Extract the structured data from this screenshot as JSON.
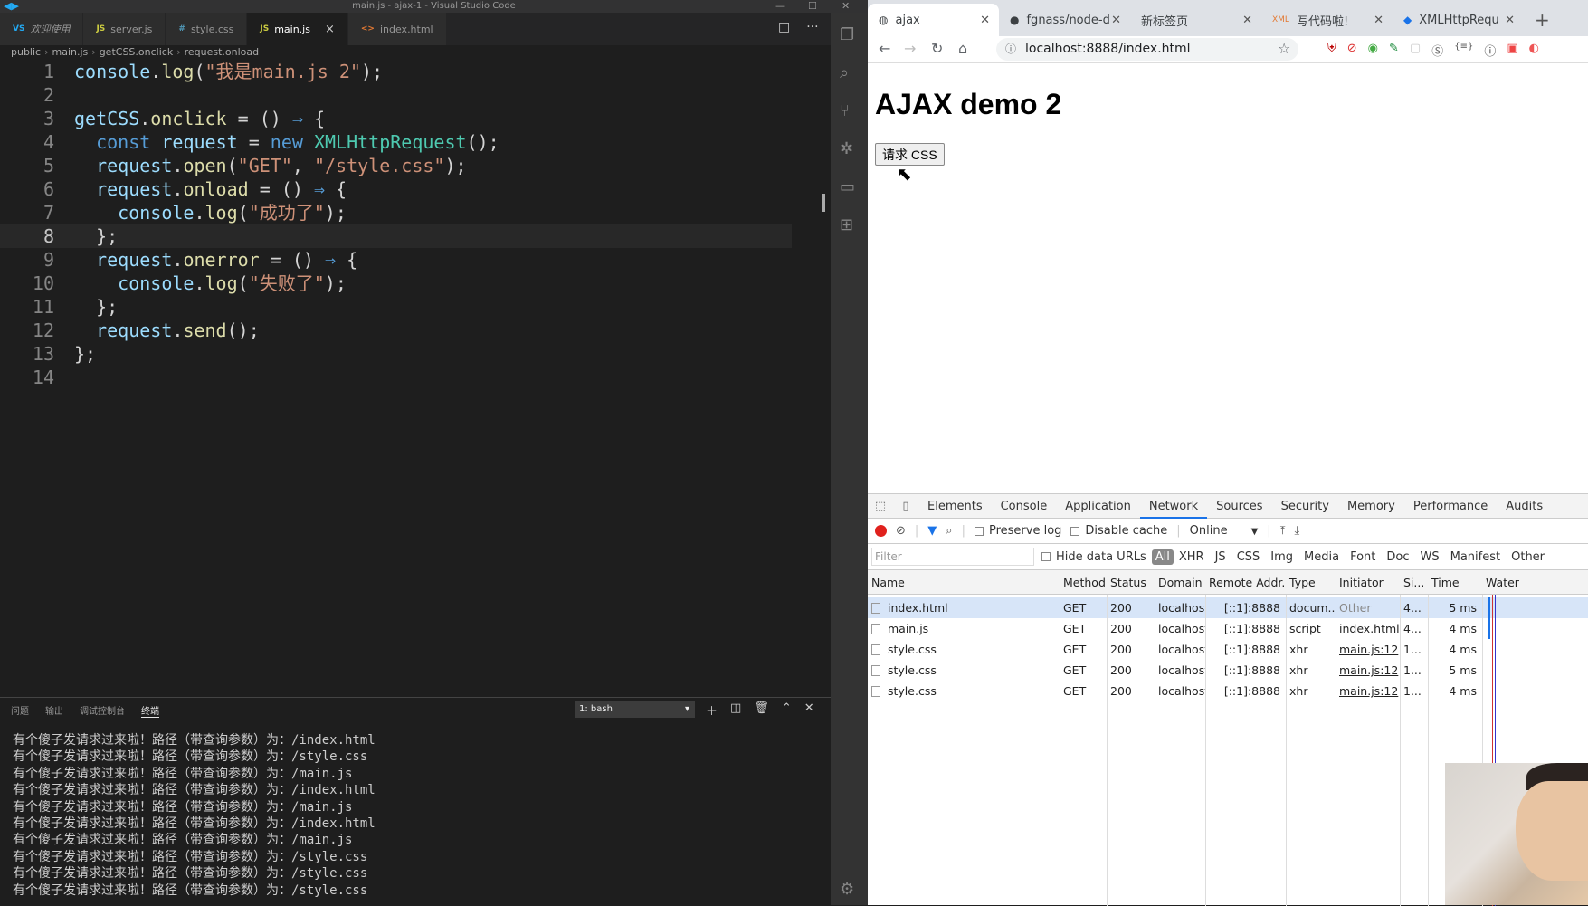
{
  "vscode": {
    "window_title": "main.js - ajax-1 - Visual Studio Code",
    "tabs": [
      {
        "icon": "VS",
        "label": "欢迎使用",
        "active": false
      },
      {
        "icon": "JS",
        "label": "server.js",
        "active": false
      },
      {
        "icon": "#",
        "label": "style.css",
        "active": false
      },
      {
        "icon": "JS",
        "label": "main.js",
        "active": true
      },
      {
        "icon": "<>",
        "label": "index.html",
        "active": false
      }
    ],
    "breadcrumb": [
      "public",
      "main.js",
      "getCSS.onclick",
      "request.onload"
    ],
    "code_lines": [
      "console.log(\"我是main.js 2\");",
      "",
      "getCSS.onclick = () ⇒ {",
      "  const request = new XMLHttpRequest();",
      "  request.open(\"GET\", \"/style.css\");",
      "  request.onload = () ⇒ {",
      "    console.log(\"成功了\");",
      "  };",
      "  request.onerror = () ⇒ {",
      "    console.log(\"失败了\");",
      "  };",
      "  request.send();",
      "};",
      ""
    ],
    "current_line": 8,
    "panel_tabs": [
      "问题",
      "输出",
      "调试控制台",
      "终端"
    ],
    "active_panel_tab": "终端",
    "terminal_select": "1: bash",
    "terminal_lines": [
      "有个傻子发请求过来啦！路径（带查询参数）为：/index.html",
      "有个傻子发请求过来啦！路径（带查询参数）为：/style.css",
      "有个傻子发请求过来啦！路径（带查询参数）为：/main.js",
      "有个傻子发请求过来啦！路径（带查询参数）为：/index.html",
      "有个傻子发请求过来啦！路径（带查询参数）为：/main.js",
      "有个傻子发请求过来啦！路径（带查询参数）为：/index.html",
      "有个傻子发请求过来啦！路径（带查询参数）为：/main.js",
      "有个傻子发请求过来啦！路径（带查询参数）为：/style.css",
      "有个傻子发请求过来啦！路径（带查询参数）为：/style.css",
      "有个傻子发请求过来啦！路径（带查询参数）为：/style.css"
    ]
  },
  "browser": {
    "tabs": [
      {
        "label": "ajax",
        "active": true
      },
      {
        "label": "fgnass/node-d",
        "active": false
      },
      {
        "label": "新标签页",
        "active": false
      },
      {
        "label": "写代码啦!",
        "active": false
      },
      {
        "label": "XMLHttpRequ",
        "active": false
      }
    ],
    "url": "localhost:8888/index.html",
    "page": {
      "heading": "AJAX demo 2",
      "button_label": "请求 CSS"
    },
    "devtools": {
      "tabs": [
        "Elements",
        "Console",
        "Application",
        "Network",
        "Sources",
        "Security",
        "Memory",
        "Performance",
        "Audits"
      ],
      "active_tab": "Network",
      "preserve_log": "Preserve log",
      "disable_cache": "Disable cache",
      "throttle": "Online",
      "filter_placeholder": "Filter",
      "hide_data_urls": "Hide data URLs",
      "type_filters": [
        "All",
        "XHR",
        "JS",
        "CSS",
        "Img",
        "Media",
        "Font",
        "Doc",
        "WS",
        "Manifest",
        "Other"
      ],
      "columns": [
        "Name",
        "Method",
        "Status",
        "Domain",
        "Remote Addr...",
        "Type",
        "Initiator",
        "Si...",
        "Time",
        "Water"
      ],
      "rows": [
        {
          "name": "index.html",
          "method": "GET",
          "status": "200",
          "domain": "localhost",
          "remote": "[::1]:8888",
          "type": "docum...",
          "initiator": "Other",
          "size": "4...",
          "time": "5 ms"
        },
        {
          "name": "main.js",
          "method": "GET",
          "status": "200",
          "domain": "localhost",
          "remote": "[::1]:8888",
          "type": "script",
          "initiator": "index.html",
          "size": "4...",
          "time": "4 ms"
        },
        {
          "name": "style.css",
          "method": "GET",
          "status": "200",
          "domain": "localhost",
          "remote": "[::1]:8888",
          "type": "xhr",
          "initiator": "main.js:12",
          "size": "1...",
          "time": "4 ms"
        },
        {
          "name": "style.css",
          "method": "GET",
          "status": "200",
          "domain": "localhost",
          "remote": "[::1]:8888",
          "type": "xhr",
          "initiator": "main.js:12",
          "size": "1...",
          "time": "5 ms"
        },
        {
          "name": "style.css",
          "method": "GET",
          "status": "200",
          "domain": "localhost",
          "remote": "[::1]:8888",
          "type": "xhr",
          "initiator": "main.js:12",
          "size": "1...",
          "time": "4 ms"
        }
      ]
    }
  },
  "colors": {
    "editor_bg": "#1e1e1e",
    "keyword": "#569cd6",
    "string": "#ce9178",
    "function": "#dcdcaa",
    "record": "#e0211d",
    "selected_row": "#d7e5f8"
  }
}
